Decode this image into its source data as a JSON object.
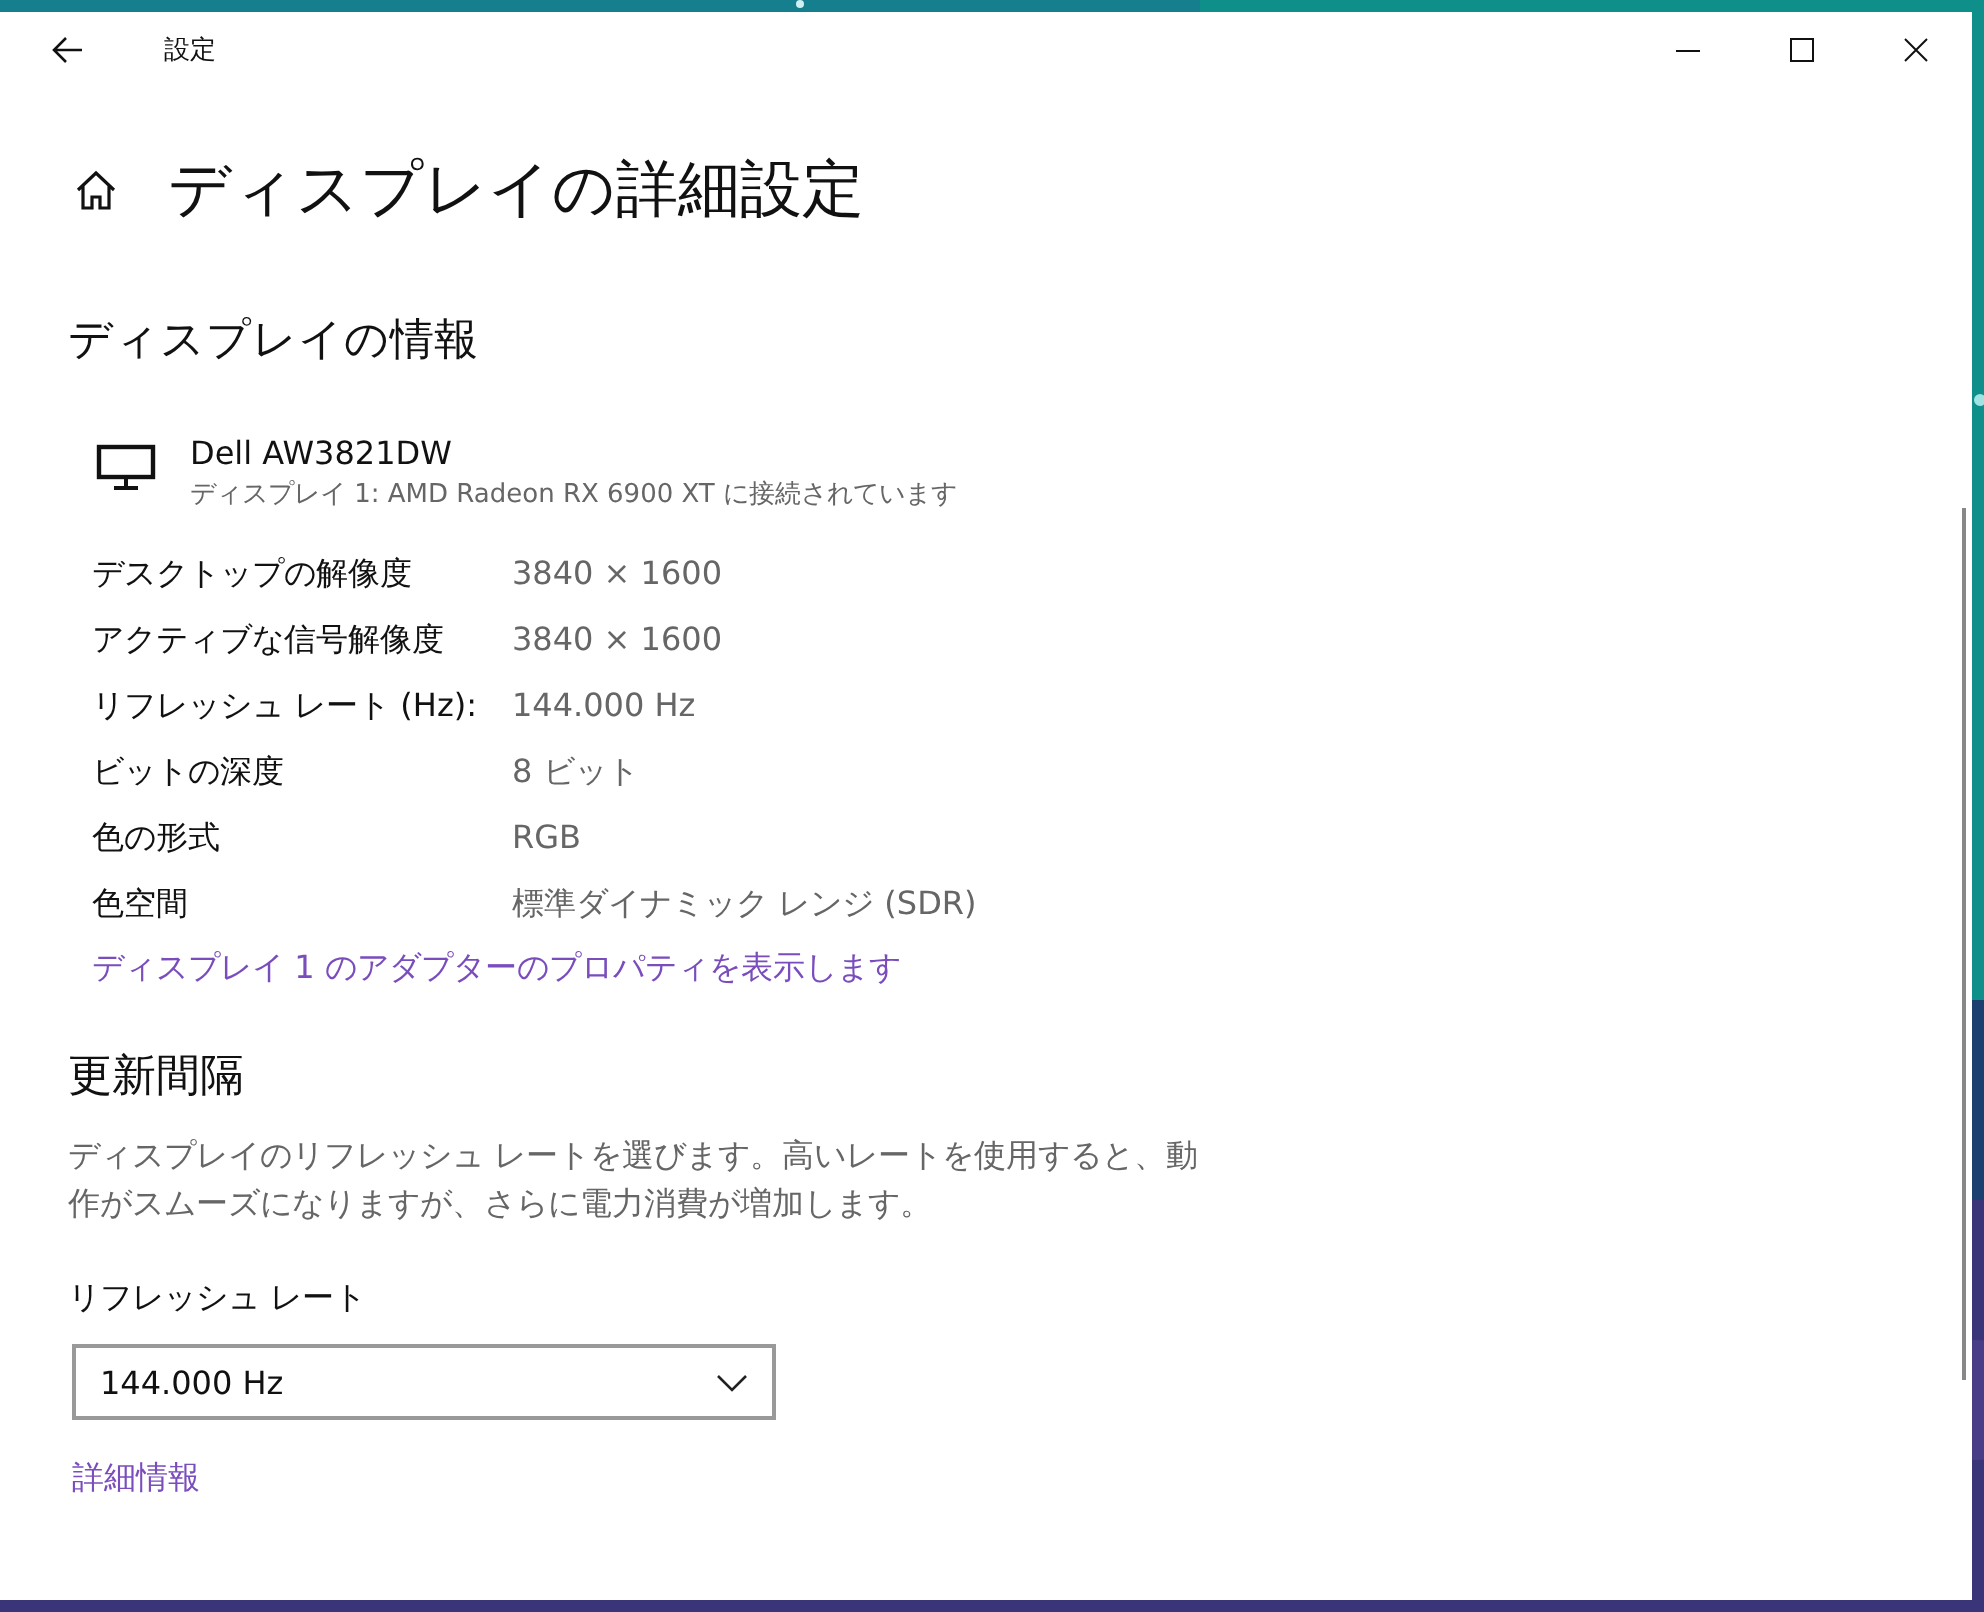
{
  "window": {
    "title": "設定"
  },
  "page": {
    "heading": "ディスプレイの詳細設定"
  },
  "display_info": {
    "heading": "ディスプレイの情報",
    "monitor": {
      "name": "Dell AW3821DW",
      "connection": "ディスプレイ 1: AMD Radeon RX 6900 XT に接続されています"
    },
    "rows": [
      {
        "label": "デスクトップの解像度",
        "value": "3840 × 1600"
      },
      {
        "label": "アクティブな信号解像度",
        "value": "3840 × 1600"
      },
      {
        "label": "リフレッシュ レート (Hz):",
        "value": "144.000 Hz"
      },
      {
        "label": "ビットの深度",
        "value": "8 ビット"
      },
      {
        "label": "色の形式",
        "value": "RGB"
      },
      {
        "label": "色空間",
        "value": "標準ダイナミック レンジ (SDR)"
      }
    ],
    "link": "ディスプレイ 1 のアダプターのプロパティを表示します"
  },
  "refresh": {
    "heading": "更新間隔",
    "description": "ディスプレイのリフレッシュ レートを選びます。高いレートを使用すると、動作がスムーズになりますが、さらに電力消費が増加します。",
    "field_label": "リフレッシュ レート",
    "dropdown": {
      "value": "144.000 Hz"
    },
    "link": "詳細情報"
  }
}
